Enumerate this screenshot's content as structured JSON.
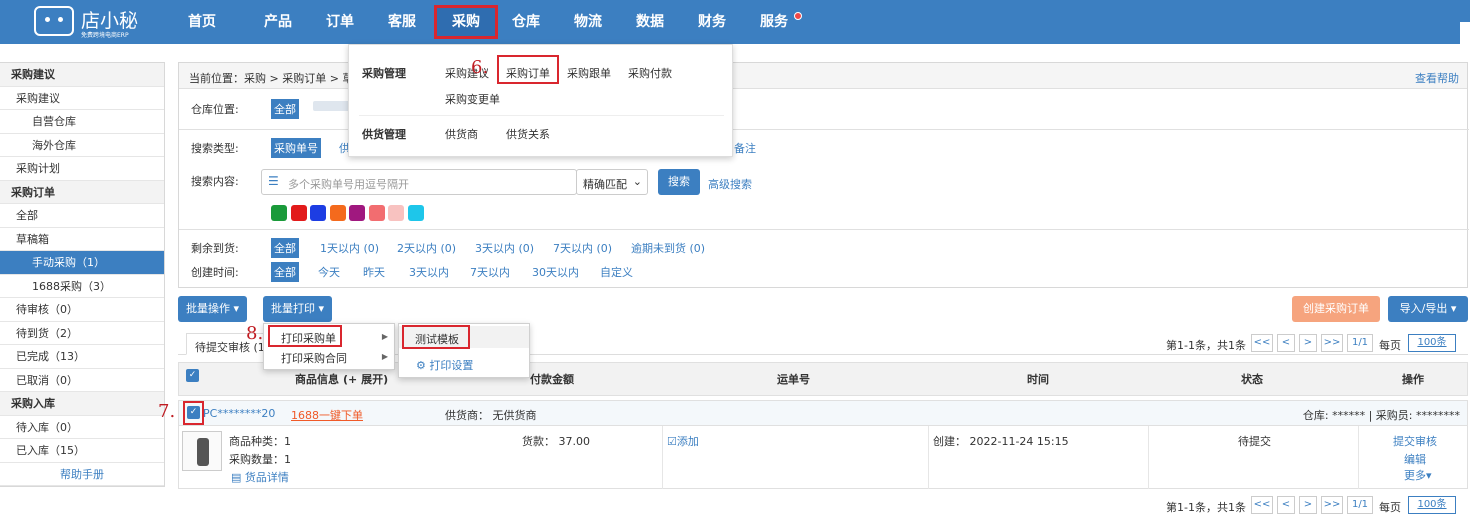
{
  "logo": {
    "name": "店小秘",
    "sub": "免费跨境电商ERP"
  },
  "nav": [
    "首页",
    "产品",
    "订单",
    "客服",
    "采购",
    "仓库",
    "物流",
    "数据",
    "财务",
    "服务"
  ],
  "sidebar": [
    {
      "t": "采购建议",
      "k": "head"
    },
    {
      "t": "采购建议",
      "k": "item"
    },
    {
      "t": "自营仓库",
      "k": "sub"
    },
    {
      "t": "海外仓库",
      "k": "sub"
    },
    {
      "t": "采购计划",
      "k": "item"
    },
    {
      "t": "采购订单",
      "k": "head"
    },
    {
      "t": "全部",
      "k": "item"
    },
    {
      "t": "草稿箱",
      "k": "item"
    },
    {
      "t": "手动采购（1）",
      "k": "active"
    },
    {
      "t": "1688采购（3）",
      "k": "sub"
    },
    {
      "t": "待审核（0）",
      "k": "item"
    },
    {
      "t": "待到货（2）",
      "k": "item"
    },
    {
      "t": "已完成（13）",
      "k": "item"
    },
    {
      "t": "已取消（0）",
      "k": "item"
    },
    {
      "t": "采购入库",
      "k": "head"
    },
    {
      "t": "待入库（0）",
      "k": "item"
    },
    {
      "t": "已入库（15）",
      "k": "item"
    },
    {
      "t": "帮助手册",
      "k": "help"
    }
  ],
  "breadcrumb": "当前位置：采购 > 采购订单 > 草稿",
  "help_link": "查看帮助",
  "filters": {
    "warehouse_label": "仓库位置:",
    "warehouse_all": "全部",
    "search_type_label": "搜索类型:",
    "search_type_active": "采购单号",
    "search_type_more": "供",
    "search_type_note": "备注",
    "search_content_label": "搜索内容:",
    "search_placeholder": "多个采购单号用逗号隔开",
    "match_select": "精确匹配",
    "search_btn": "搜索",
    "advanced": "高级搜索",
    "colors": [
      "#1a9a3a",
      "#e21b1b",
      "#1d3de3",
      "#f46a1d",
      "#a0187f",
      "#f26d70",
      "#f8c2c0",
      "#1ec6ea"
    ],
    "arrival_label": "剩余到货:",
    "arrival_options": [
      "全部",
      "1天以内 (0)",
      "2天以内 (0)",
      "3天以内 (0)",
      "7天以内 (0)",
      "逾期未到货 (0)"
    ],
    "created_label": "创建时间:",
    "created_options": [
      "全部",
      "今天",
      "昨天",
      "3天以内",
      "7天以内",
      "30天以内",
      "自定义"
    ]
  },
  "actions": {
    "batch_op": "批量操作 ▾",
    "batch_print": "批量打印 ▾",
    "create": "创建采购订单",
    "import_export": "导入/导出 ▾"
  },
  "dropdown": {
    "group1": "采购管理",
    "items1": [
      "采购建议",
      "采购订单",
      "采购跟单",
      "采购付款",
      "采购变更单"
    ],
    "group2": "供货管理",
    "items2": [
      "供货商",
      "供货关系"
    ]
  },
  "print_menu": {
    "items": [
      "打印采购单",
      "打印采购合同"
    ],
    "sub": [
      "测试模板",
      "打印设置"
    ]
  },
  "tab": "待提交审核 (1)",
  "pagination": {
    "summary": "第1-1条，共1条",
    "first": "<<",
    "prev": "<",
    "next": ">",
    "last": ">>",
    "page": "1/1",
    "per_page_label": "每页",
    "per_page": "100条"
  },
  "table": {
    "headers": [
      "商品信息",
      "(+ 展开)",
      "付款金额",
      "运单号",
      "时间",
      "状态",
      "操作"
    ],
    "order_no": "PC********20",
    "link_1688": "1688一键下单",
    "supplier": "供货商：  无供货商",
    "warehouse": "仓库: ****** | 采购员: ********",
    "kinds": "商品种类：1",
    "qty": "采购数量：1",
    "details": "货品详情",
    "payment": "货款：  37.00",
    "add": "添加",
    "created": "创建：  2022-11-24 15:15",
    "status": "待提交",
    "ops": [
      "提交审核",
      "编辑",
      "更多"
    ]
  },
  "steps": [
    "6.",
    "7.",
    "8."
  ]
}
